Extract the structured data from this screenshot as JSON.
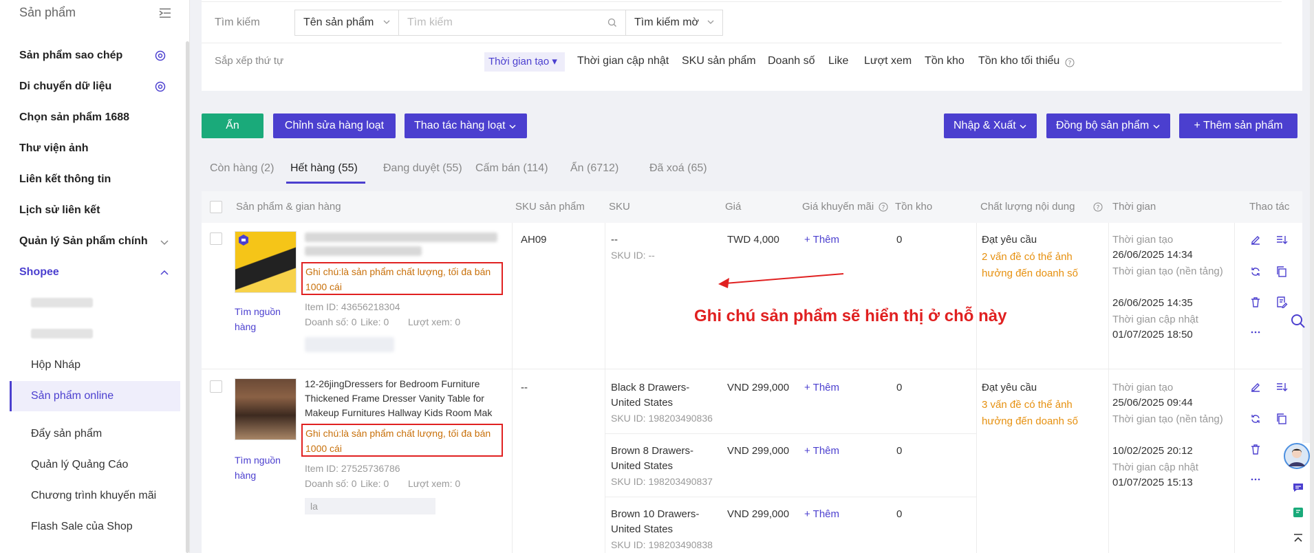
{
  "sidebar": {
    "title": "Sản phẩm",
    "items": [
      {
        "label": "Sản phẩm sao chép"
      },
      {
        "label": "Di chuyển dữ liệu"
      },
      {
        "label": "Chọn sản phẩm 1688"
      },
      {
        "label": "Thư viện ảnh"
      },
      {
        "label": "Liên kết thông tin"
      },
      {
        "label": "Lịch sử liên kết"
      },
      {
        "label": "Quản lý Sản phẩm chính"
      },
      {
        "label": "Shopee"
      }
    ],
    "sub": {
      "draft": "Hộp Nháp",
      "online": "Sản phẩm online",
      "push": "Đẩy sản phẩm",
      "ads": "Quản lý Quảng Cáo",
      "promo": "Chương trình khuyến mãi",
      "flash": "Flash Sale của Shop"
    }
  },
  "search": {
    "label": "Tìm kiếm",
    "field": "Tên sản phẩm",
    "placeholder": "Tìm kiếm",
    "mode": "Tìm kiếm mờ"
  },
  "sort": {
    "label": "Sắp xếp thứ tự",
    "options": [
      "Thời gian tạo ▾",
      "Thời gian cập nhật",
      "SKU sản phẩm",
      "Doanh số",
      "Like",
      "Lượt xem",
      "Tồn kho",
      "Tồn kho tối thiểu"
    ]
  },
  "toolbar": {
    "hide": "Ẩn",
    "bulk_edit": "Chỉnh sửa hàng loạt",
    "bulk_ops": "Thao tác hàng loạt",
    "import_export": "Nhập & Xuất",
    "sync": "Đồng bộ sản phẩm",
    "add": "+ Thêm sản phẩm"
  },
  "tabs": [
    "Còn hàng (2)",
    "Hết hàng (55)",
    "Đang duyệt (55)",
    "Cấm bán (114)",
    "Ẩn (6712)",
    "Đã xoá (65)"
  ],
  "columns": [
    "Sản phẩm & gian hàng",
    "SKU sản phẩm",
    "SKU",
    "Giá",
    "Giá khuyến mãi",
    "Tồn kho",
    "Chất lượng nội dung",
    "Thời gian",
    "Thao tác"
  ],
  "rows": [
    {
      "title_blur": "1111111111ncatwte11111test 6 AbUnixes 2B 木箱備莉繡支式子8626",
      "note": "Ghi chú:là sản phẩm chất lượng, tối đa bán 1000 cái",
      "source": "Tìm nguồn hàng",
      "item_id": "Item ID: 43656218304",
      "sales": "Doanh số: 0",
      "like": "Like: 0",
      "views": "Lượt xem: 0",
      "shop_blur": "台湾TW测试店铺",
      "sku_product": "AH09",
      "variants": [
        {
          "sku": "--",
          "sku_id": "SKU ID: --",
          "price": "TWD 4,000",
          "promo": "+ Thêm",
          "stock": "0"
        }
      ],
      "quality": "Đạt yêu cầu",
      "issues": "2 vấn đề có thể ảnh hưởng đến doanh số",
      "t1l": "Thời gian tạo",
      "t1": "26/06/2025 14:34",
      "t2l": "Thời gian tạo (nền tảng)",
      "t2": "26/06/2025 14:35",
      "t3l": "Thời gian cập nhật",
      "t3": "01/07/2025 18:50"
    },
    {
      "title": "12-26jingDressers for Bedroom Furniture Thickened Frame Dresser Vanity Table for Makeup Furnitures Hallway Kids Room Mak",
      "note": "Ghi chú:là sản phẩm chất lượng, tối đa bán 1000 cái",
      "source": "Tìm nguồn hàng",
      "item_id": "Item ID: 27525736786",
      "sales": "Doanh số: 0",
      "like": "Like: 0",
      "views": "Lượt xem: 0",
      "shop_blur": "la",
      "sku_product": "--",
      "variants": [
        {
          "sku": "Black  8 Drawers-United States",
          "sku_id": "SKU ID: 198203490836",
          "price": "VND 299,000",
          "promo": "+ Thêm",
          "stock": "0"
        },
        {
          "sku": "Brown  8 Drawers-United States",
          "sku_id": "SKU ID: 198203490837",
          "price": "VND 299,000",
          "promo": "+ Thêm",
          "stock": "0"
        },
        {
          "sku": "Brown  10 Drawers-United States",
          "sku_id": "SKU ID: 198203490838",
          "price": "VND 299,000",
          "promo": "+ Thêm",
          "stock": "0"
        }
      ],
      "quality": "Đạt yêu cầu",
      "issues": "3 vấn đề có thể ảnh hưởng đến doanh số",
      "t1l": "Thời gian tạo",
      "t1": "25/06/2025 09:44",
      "t2l": "Thời gian tạo (nền tảng)",
      "t2": "10/02/2025 20:12",
      "t3l": "Thời gian cập nhật",
      "t3": "01/07/2025 15:13"
    }
  ],
  "annotation": "Ghi chú sản phẩm sẽ hiển thị ở chỗ này",
  "colors": {
    "accent": "#4b3fcf",
    "green": "#1aaa7a",
    "warning": "#e6900f",
    "annotation": "#e02020"
  }
}
